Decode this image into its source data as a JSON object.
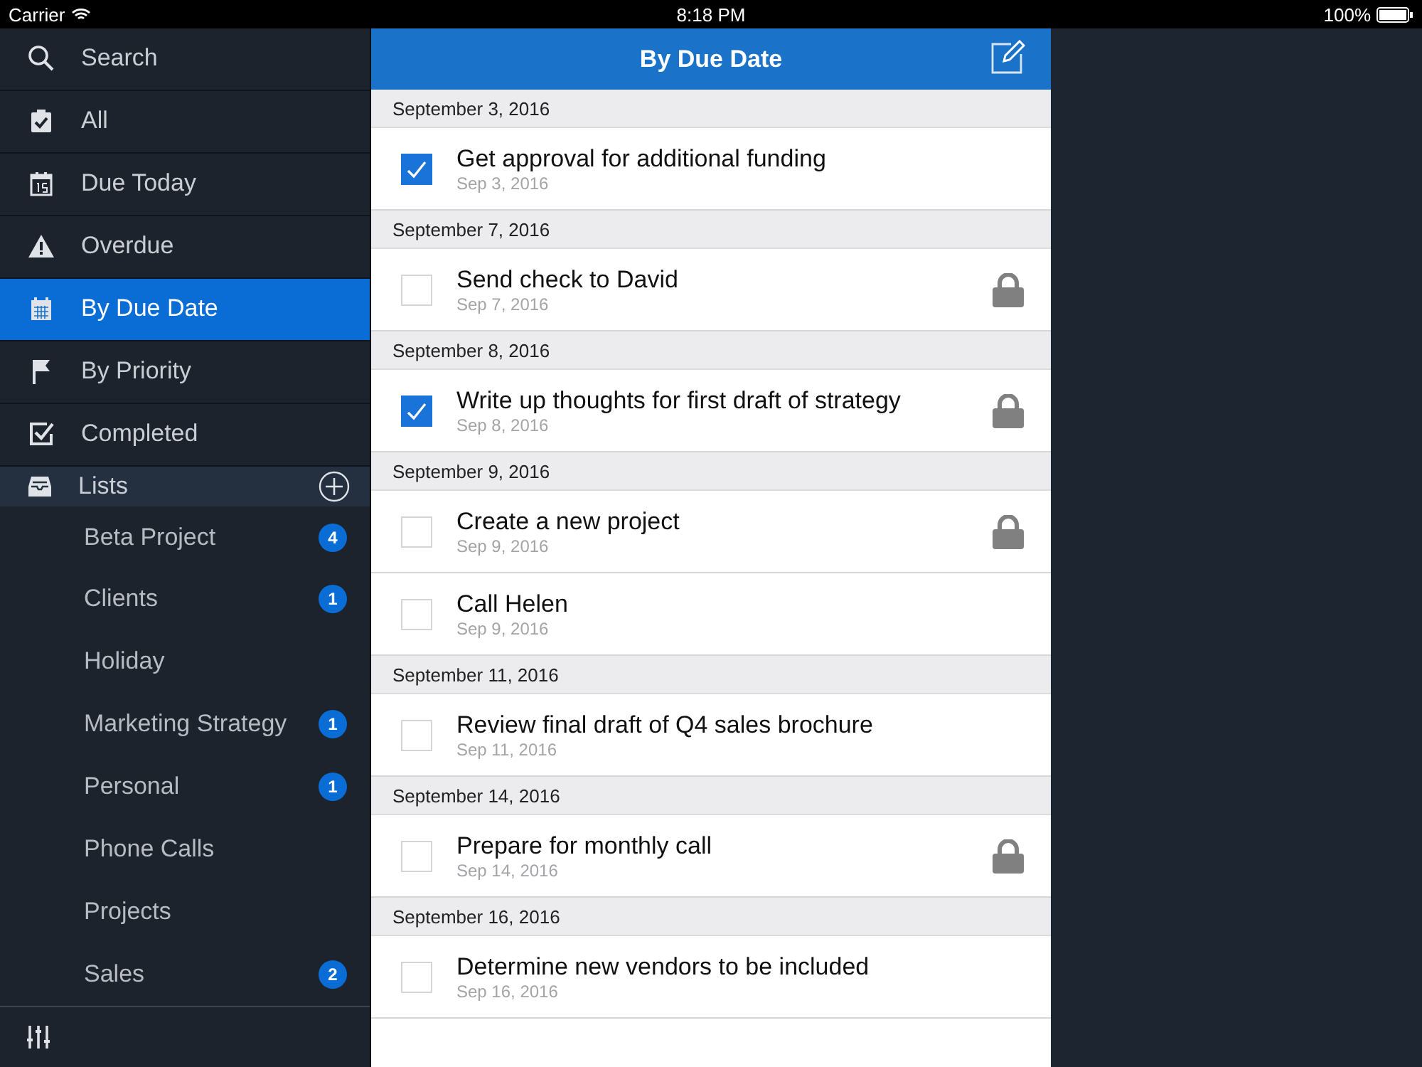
{
  "status_bar": {
    "carrier": "Carrier",
    "time": "8:18 PM",
    "battery": "100%"
  },
  "sidebar": {
    "items": [
      {
        "label": "Search",
        "selected": false
      },
      {
        "label": "All",
        "selected": false
      },
      {
        "label": "Due Today",
        "selected": false
      },
      {
        "label": "Overdue",
        "selected": false
      },
      {
        "label": "By Due Date",
        "selected": true
      },
      {
        "label": "By Priority",
        "selected": false
      },
      {
        "label": "Completed",
        "selected": false
      }
    ],
    "lists_header": "Lists",
    "lists": [
      {
        "label": "Beta Project",
        "count": "4"
      },
      {
        "label": "Clients",
        "count": "1"
      },
      {
        "label": "Holiday"
      },
      {
        "label": "Marketing Strategy",
        "count": "1"
      },
      {
        "label": "Personal",
        "count": "1"
      },
      {
        "label": "Phone Calls"
      },
      {
        "label": "Projects"
      },
      {
        "label": "Sales",
        "count": "2"
      }
    ]
  },
  "header": {
    "title": "By Due Date"
  },
  "sections": [
    {
      "heading": "September 3, 2016",
      "tasks": [
        {
          "title": "Get approval for additional funding",
          "date": "Sep 3, 2016",
          "checked": true,
          "locked": false
        }
      ]
    },
    {
      "heading": "September 7, 2016",
      "tasks": [
        {
          "title": "Send check to David",
          "date": "Sep 7, 2016",
          "checked": false,
          "locked": true
        }
      ]
    },
    {
      "heading": "September 8, 2016",
      "tasks": [
        {
          "title": "Write up thoughts for first draft of strategy",
          "date": "Sep 8, 2016",
          "checked": true,
          "locked": true
        }
      ]
    },
    {
      "heading": "September 9, 2016",
      "tasks": [
        {
          "title": "Create a new project",
          "date": "Sep 9, 2016",
          "checked": false,
          "locked": true
        },
        {
          "title": "Call Helen",
          "date": "Sep 9, 2016",
          "checked": false,
          "locked": false
        }
      ]
    },
    {
      "heading": "September 11, 2016",
      "tasks": [
        {
          "title": "Review final draft of Q4 sales brochure",
          "date": "Sep 11, 2016",
          "checked": false,
          "locked": false
        }
      ]
    },
    {
      "heading": "September 14, 2016",
      "tasks": [
        {
          "title": "Prepare for monthly call",
          "date": "Sep 14, 2016",
          "checked": false,
          "locked": true
        }
      ]
    },
    {
      "heading": "September 16, 2016",
      "tasks": [
        {
          "title": "Determine new vendors to be included",
          "date": "Sep 16, 2016",
          "checked": false,
          "locked": false
        }
      ]
    }
  ]
}
